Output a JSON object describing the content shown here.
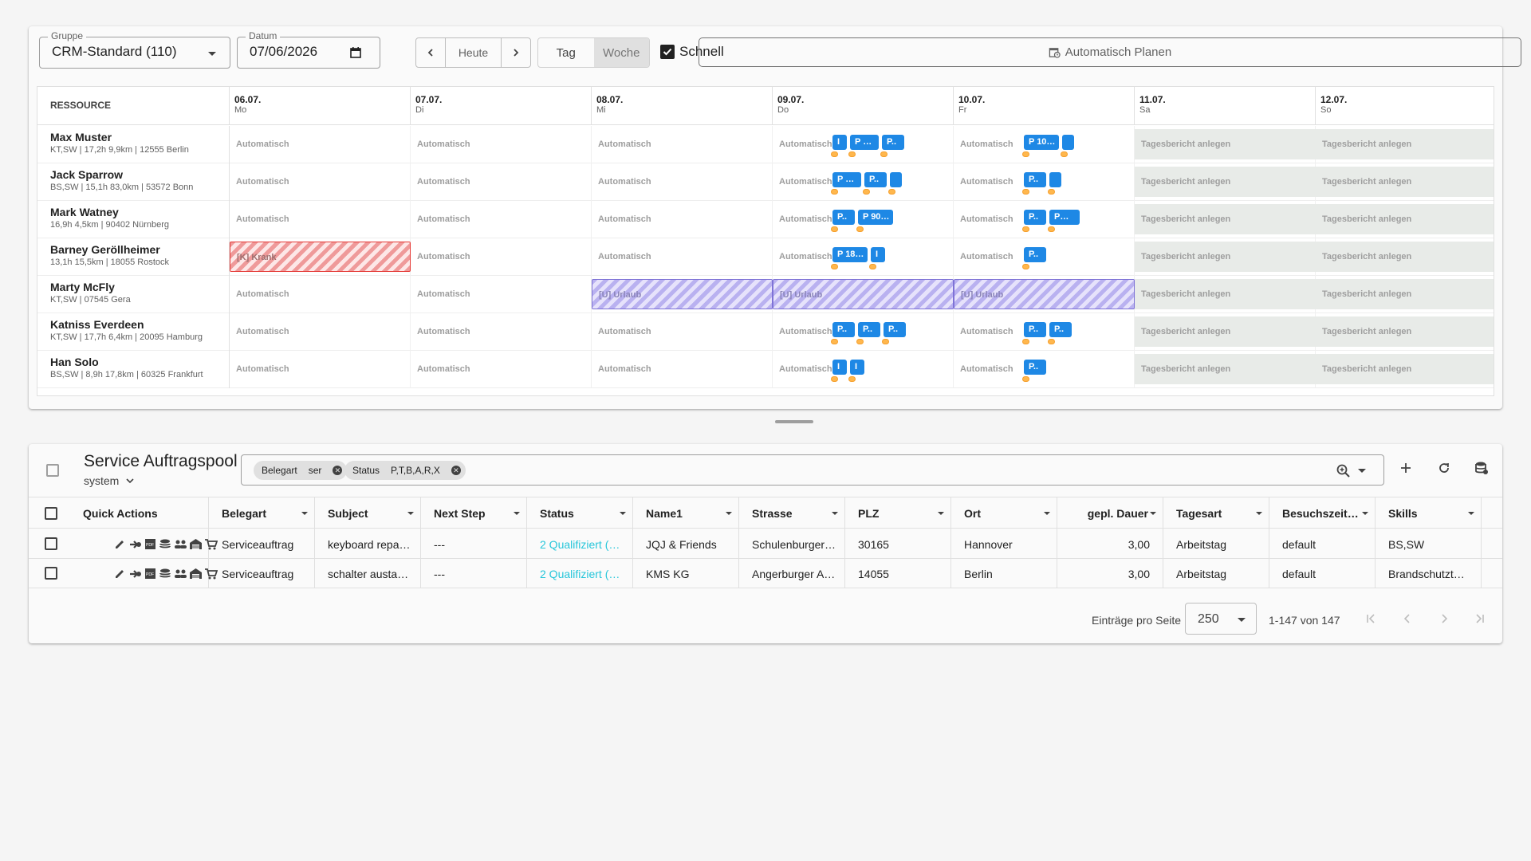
{
  "toolbar": {
    "gruppe_label": "Gruppe",
    "gruppe_value": "CRM-Standard (110)",
    "datum_label": "Datum",
    "datum_value": "07/06/2026",
    "heute": "Heute",
    "view_tag": "Tag",
    "view_woche": "Woche",
    "active_view": "Woche",
    "schnell_label": "Schnell",
    "schnell_checked": true,
    "auto_plan": "Automatisch Planen"
  },
  "planner": {
    "resource_header": "RESSOURCE",
    "days": [
      {
        "date": "06.07.",
        "weekday": "Mo"
      },
      {
        "date": "07.07.",
        "weekday": "Di"
      },
      {
        "date": "08.07.",
        "weekday": "Mi"
      },
      {
        "date": "09.07.",
        "weekday": "Do"
      },
      {
        "date": "10.07.",
        "weekday": "Fr"
      },
      {
        "date": "11.07.",
        "weekday": "Sa"
      },
      {
        "date": "12.07.",
        "weekday": "So"
      }
    ],
    "auto_text": "Automatisch",
    "weekend_text": "Tagesbericht anlegen",
    "krank_text": "[K] Krank",
    "urlaub_text": "[U] Urlaub",
    "resources": [
      {
        "name": "Max Muster",
        "info": "KT,SW | 17,2h 9,9km | 12555 Berlin",
        "thu_jobs": [
          "I",
          "P …",
          "P.."
        ],
        "fri_jobs": [
          "P 10…",
          ""
        ]
      },
      {
        "name": "Jack Sparrow",
        "info": "BS,SW | 15,1h 83,0km | 53572 Bonn",
        "thu_jobs": [
          "P …",
          "P..",
          ""
        ],
        "fri_jobs": [
          "P..",
          ""
        ]
      },
      {
        "name": "Mark Watney",
        "info": "16,9h 4,5km | 90402 Nürnberg",
        "thu_jobs": [
          "P..",
          "P 90…"
        ],
        "fri_jobs": [
          "P..",
          "P…"
        ]
      },
      {
        "name": "Barney Geröllheimer",
        "info": "13,1h 15,5km | 18055 Rostock",
        "thu_jobs": [
          "P 18…",
          "I"
        ],
        "fri_jobs": [
          "P.."
        ]
      },
      {
        "name": "Marty McFly",
        "info": "KT,SW | 07545 Gera",
        "thu_jobs": [],
        "fri_jobs": []
      },
      {
        "name": "Katniss Everdeen",
        "info": "KT,SW | 17,7h 6,4km | 20095 Hamburg",
        "thu_jobs": [
          "P..",
          "P..",
          "P.."
        ],
        "fri_jobs": [
          "P..",
          "P.."
        ]
      },
      {
        "name": "Han Solo",
        "info": "BS,SW | 8,9h 17,8km | 60325 Frankfurt",
        "thu_jobs": [
          "I",
          "I"
        ],
        "fri_jobs": [
          "P.."
        ]
      }
    ]
  },
  "pool": {
    "title": "Service Auftragspool",
    "view": "system",
    "filters": [
      {
        "field": "Belegart",
        "value": "ser"
      },
      {
        "field": "Status",
        "value": "P,T,B,A,R,X"
      }
    ],
    "columns": [
      "Quick Actions",
      "Belegart",
      "Subject",
      "Next Step",
      "Status",
      "Name1",
      "Strasse",
      "PLZ",
      "Ort",
      "gepl. Dauer",
      "Tagesart",
      "Besuchszeit…",
      "Skills"
    ],
    "rows": [
      [
        "Serviceauftrag",
        "keyboard repa…",
        "---",
        "2 Qualifiziert (…",
        "JQJ & Friends",
        "Schulenburger…",
        "30165",
        "Hannover",
        "3,00",
        "Arbeitstag",
        "default",
        "BS,SW"
      ],
      [
        "Serviceauftrag",
        "schalter austa…",
        "---",
        "2 Qualifiziert (…",
        "KMS KG",
        "Angerburger A…",
        "14055",
        "Berlin",
        "3,00",
        "Arbeitstag",
        "default",
        "Brandschutzt…"
      ]
    ],
    "per_page_label": "Einträge pro Seite",
    "per_page": "250",
    "range": "1-147 von 147"
  }
}
